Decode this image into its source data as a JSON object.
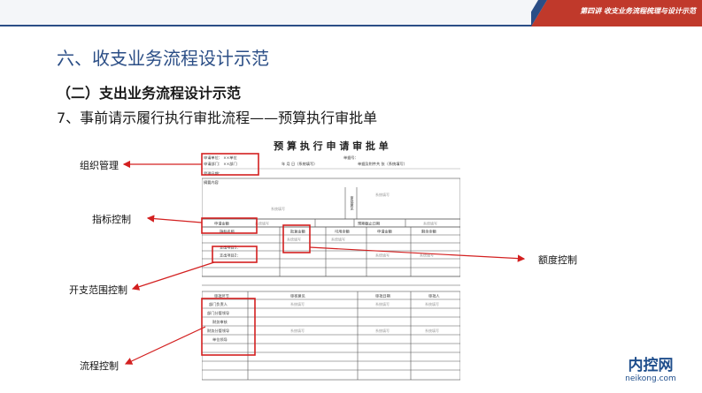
{
  "header": {
    "chapter": "第四讲  收支业务流程梳理与设计示范"
  },
  "title": "六、收支业务流程设计示范",
  "subtitle": "（二）支出业务流程设计示范",
  "item": "7、事前请示履行执行审批流程——预算执行审批单",
  "form": {
    "title": "预 算 执 行 申 请 审 批 单",
    "row1_left": "申请单位：  ××单位",
    "row1_mid": "单据号：",
    "row2_left": "申请部门：  ××部门",
    "row2_mid": "年    月    日（系统填写）",
    "row2_right": "单据及附件共     张（系统填写）",
    "row3_left": "受理日期：",
    "summary": "摘要内容",
    "stamp_field": "审批意见",
    "budget_amount": "申请金额",
    "system_fill": "系统填写",
    "budget_deadline": "预期截止日期",
    "col_headers": [
      "指标名称",
      "批复金额",
      "可用余额",
      "申请金额",
      "剩余余额"
    ],
    "expense1": "支出项目1：",
    "expense2": "支出项目2：",
    "approval_headers": [
      "审批环节",
      "审核意见",
      "审批日期",
      "审批人"
    ],
    "approval_roles": [
      "部门负责人",
      "部门分管领导",
      "财务审核",
      "财务分管领导",
      "单位领导"
    ]
  },
  "annotations": {
    "org": "组织管理",
    "indicator": "指标控制",
    "scope": "开支范围控制",
    "process": "流程控制",
    "amount": "额度控制"
  },
  "brand": {
    "cn": "内控网",
    "en": "neikong.com"
  },
  "colors": {
    "accent": "#2b4e86",
    "tab_red": "#c0392b",
    "box_red": "#d32020"
  }
}
